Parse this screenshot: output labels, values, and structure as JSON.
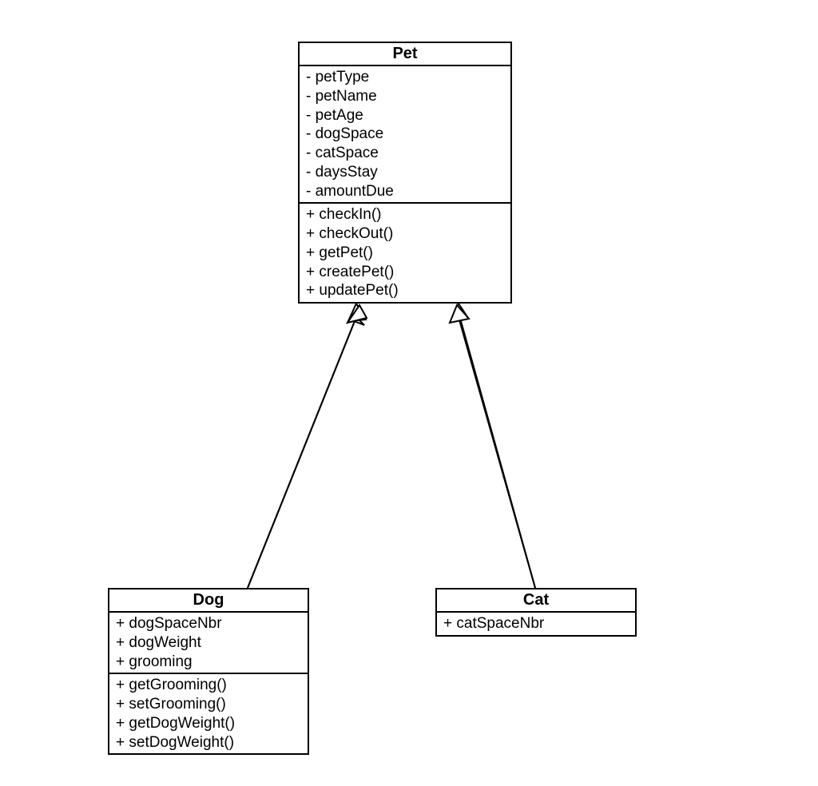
{
  "classes": {
    "pet": {
      "name": "Pet",
      "attributes": [
        "- petType",
        "- petName",
        "- petAge",
        "- dogSpace",
        "- catSpace",
        "- daysStay",
        "- amountDue"
      ],
      "methods": [
        "+ checkIn()",
        "+ checkOut()",
        "+ getPet()",
        "+ createPet()",
        "+ updatePet()"
      ]
    },
    "dog": {
      "name": "Dog",
      "attributes": [
        "+ dogSpaceNbr",
        "+ dogWeight",
        "+ grooming"
      ],
      "methods": [
        "+ getGrooming()",
        "+ setGrooming()",
        "+ getDogWeight()",
        "+ setDogWeight()"
      ]
    },
    "cat": {
      "name": "Cat",
      "attributes": [
        "+ catSpaceNbr"
      ],
      "methods": []
    }
  }
}
